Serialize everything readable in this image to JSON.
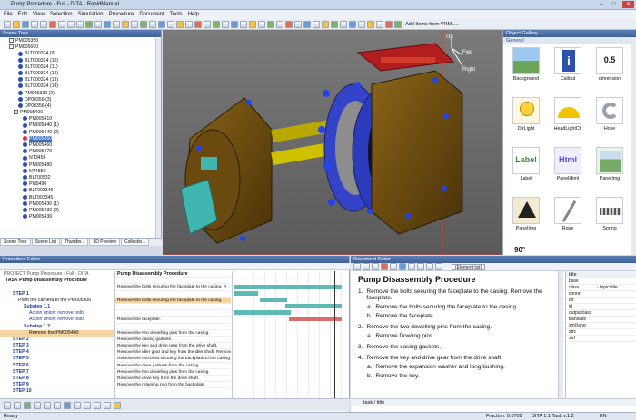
{
  "window": {
    "title": "Pump Procedure - Full - DITA - RapidManual"
  },
  "menu": [
    "File",
    "Edit",
    "View",
    "Selection",
    "Simulation",
    "Procedure",
    "Document",
    "Tools",
    "Help"
  ],
  "toolbar": {
    "add_items_label": "Add Items from VRML..."
  },
  "scene_tree": {
    "title": "Scene Tree",
    "rows": [
      {
        "label": "PM005350",
        "indent": 2,
        "kind": "cb"
      },
      {
        "label": "PM005600",
        "indent": 2,
        "kind": "cb"
      },
      {
        "label": "BLT000324 (9)",
        "indent": 4,
        "kind": "dot"
      },
      {
        "label": "BLT000324 (10)",
        "indent": 4,
        "kind": "dot"
      },
      {
        "label": "BLT000324 (11)",
        "indent": 4,
        "kind": "dot"
      },
      {
        "label": "BLT000324 (12)",
        "indent": 4,
        "kind": "dot"
      },
      {
        "label": "BLT000324 (13)",
        "indent": 4,
        "kind": "dot"
      },
      {
        "label": "BLT000324 (14)",
        "indent": 4,
        "kind": "dot"
      },
      {
        "label": "PM005330 (2)",
        "indent": 4,
        "kind": "dot"
      },
      {
        "label": "DP00356 (3)",
        "indent": 4,
        "kind": "dot"
      },
      {
        "label": "DP00356 (4)",
        "indent": 4,
        "kind": "dot"
      },
      {
        "label": "PM005400",
        "indent": 3,
        "kind": "cb"
      },
      {
        "label": "PM005410",
        "indent": 5,
        "kind": "dot"
      },
      {
        "label": "PM005440 (1)",
        "indent": 5,
        "kind": "dot"
      },
      {
        "label": "PM005440 (2)",
        "indent": 5,
        "kind": "dot"
      },
      {
        "label": "PM005450",
        "indent": 5,
        "kind": "red"
      },
      {
        "label": "PM005460",
        "indent": 5,
        "kind": "dot"
      },
      {
        "label": "PM005470",
        "indent": 5,
        "kind": "dot"
      },
      {
        "label": "NT3456",
        "indent": 5,
        "kind": "dot"
      },
      {
        "label": "PM005480",
        "indent": 5,
        "kind": "dot"
      },
      {
        "label": "NT4850",
        "indent": 5,
        "kind": "dot"
      },
      {
        "label": "BLT00532",
        "indent": 5,
        "kind": "dot"
      },
      {
        "label": "PM5490",
        "indent": 5,
        "kind": "dot"
      },
      {
        "label": "BLT003345",
        "indent": 5,
        "kind": "dot"
      },
      {
        "label": "BLT003345",
        "indent": 5,
        "kind": "dot"
      },
      {
        "label": "PM005430 (1)",
        "indent": 5,
        "kind": "dot"
      },
      {
        "label": "PM005430 (2)",
        "indent": 5,
        "kind": "dot"
      },
      {
        "label": "PM005430",
        "indent": 5,
        "kind": "dot"
      }
    ],
    "tabs": [
      "Scene Tree",
      "Scene List",
      "Thumbn...",
      "3D Preview",
      "Collectio..."
    ]
  },
  "viewport": {
    "labels": {
      "up": "Up",
      "fwd": "Fwd",
      "right": "Right"
    }
  },
  "gallery": {
    "title": "Object Gallery",
    "section": "General",
    "items": [
      {
        "label": "Background",
        "icon": "background-icon"
      },
      {
        "label": "Callout",
        "icon": "callout-icon"
      },
      {
        "label": "dimension",
        "icon": "dimension-icon",
        "text": "0.5"
      },
      {
        "label": "DirLight",
        "icon": "bulb-icon"
      },
      {
        "label": "HeadLightCtl",
        "icon": "headlight-icon"
      },
      {
        "label": "Hose",
        "icon": "hose-icon"
      },
      {
        "label": "Label",
        "icon": "label-icon",
        "text": "Label"
      },
      {
        "label": "PanelHtml",
        "icon": "html-icon",
        "text": "Html"
      },
      {
        "label": "PanelImg",
        "icon": "panelimg-icon"
      },
      {
        "label": "PanelImg",
        "icon": "warning-icon"
      },
      {
        "label": "Rope",
        "icon": "rope-icon"
      },
      {
        "label": "Spring",
        "icon": "spring-icon"
      }
    ],
    "angle_label": "90°"
  },
  "procedure_editor": {
    "title": "Procedure Editor",
    "tree": [
      {
        "text": "PROJECT Pump Procedure - Full - DITA",
        "cls": "p"
      },
      {
        "text": "TASK Pump Disassembly Procedure",
        "cls": "task"
      },
      {
        "text": "",
        "cls": ""
      },
      {
        "text": "STEP 1",
        "cls": "step"
      },
      {
        "text": "Point the camera to the PM005300",
        "cls": "sub"
      },
      {
        "text": "Substep 1.1",
        "cls": "ss"
      },
      {
        "text": "Action union: remove bolts",
        "cls": "act"
      },
      {
        "text": "Action union: remove bolts",
        "cls": "act"
      },
      {
        "text": "Substep 1.2",
        "cls": "ss"
      },
      {
        "text": "Remove the PM005400",
        "cls": "sub2"
      },
      {
        "text": "STEP 2",
        "cls": "step"
      },
      {
        "text": "STEP 3",
        "cls": "step"
      },
      {
        "text": "STEP 4",
        "cls": "step"
      },
      {
        "text": "STEP 5",
        "cls": "step"
      },
      {
        "text": "STEP 6",
        "cls": "step"
      },
      {
        "text": "STEP 7",
        "cls": "step"
      },
      {
        "text": "STEP 8",
        "cls": "step"
      },
      {
        "text": "STEP 9",
        "cls": "step"
      },
      {
        "text": "STEP 10",
        "cls": "step"
      }
    ],
    "steps_header": "Pump Disassembly Procedure",
    "steps": [
      "",
      "Remove the bolts securing the faceplate to the casing. R",
      "",
      "Remove the bolts securing the faceplate to the casing.",
      "",
      "",
      "Remove the faceplate.",
      "",
      "Remove the two dowelling pins from the casing.",
      "Remove the casing gaskets.",
      "Remove the key and drive gear from the drive shaft.",
      "Remove the idler gear and key from the idler shaft. Remove t",
      "Remove the two bolts securing the backplate to the casing and",
      "Remove the case gaskets from the casing.",
      "Remove the two dowelling pins from the casing.",
      "Remove the drive key from the drive shaft.",
      "Remove the retaining ring from the backplate."
    ]
  },
  "document_editor": {
    "title": "Document Editor",
    "element_select": "{Element list}",
    "heading": "Pump Disassembly Procedure",
    "items": [
      {
        "n": "1.",
        "text": "Remove the bolts securing the faceplate to the casing. Remove the faceplate.",
        "subs": [
          {
            "n": "a.",
            "text": "Remove the bolts securing the faceplate to the casing."
          },
          {
            "n": "b.",
            "text": "Remove the faceplate."
          }
        ]
      },
      {
        "n": "2.",
        "text": "Remove the two dowelling pins from the casing.",
        "subs": [
          {
            "n": "a.",
            "text": "Remove Dowling pins"
          }
        ]
      },
      {
        "n": "3.",
        "text": "Remove the casing gaskets.",
        "subs": []
      },
      {
        "n": "4.",
        "text": "Remove the key and drive gear from the drive shaft.",
        "subs": [
          {
            "n": "a.",
            "text": "Remove the expansion washer and long bushing."
          },
          {
            "n": "b.",
            "text": "Remove the key."
          }
        ]
      }
    ],
    "breadcrumb": "task / title",
    "attr_title": "title",
    "attrs": [
      {
        "k": "base",
        "v": ""
      },
      {
        "k": "class",
        "v": "- topic/title"
      },
      {
        "k": "conref",
        "v": ""
      },
      {
        "k": "dir",
        "v": ""
      },
      {
        "k": "id",
        "v": ""
      },
      {
        "k": "outputclass",
        "v": ""
      },
      {
        "k": "translate",
        "v": ""
      },
      {
        "k": "xml:lang",
        "v": ""
      },
      {
        "k": "xtrc",
        "v": ""
      },
      {
        "k": "xtrf",
        "v": ""
      }
    ]
  },
  "status": {
    "left": "Ready",
    "fraction": "Fraction: 0.0709",
    "dita": "DITA 1.1 Task v.1.2",
    "lang": "EN"
  }
}
